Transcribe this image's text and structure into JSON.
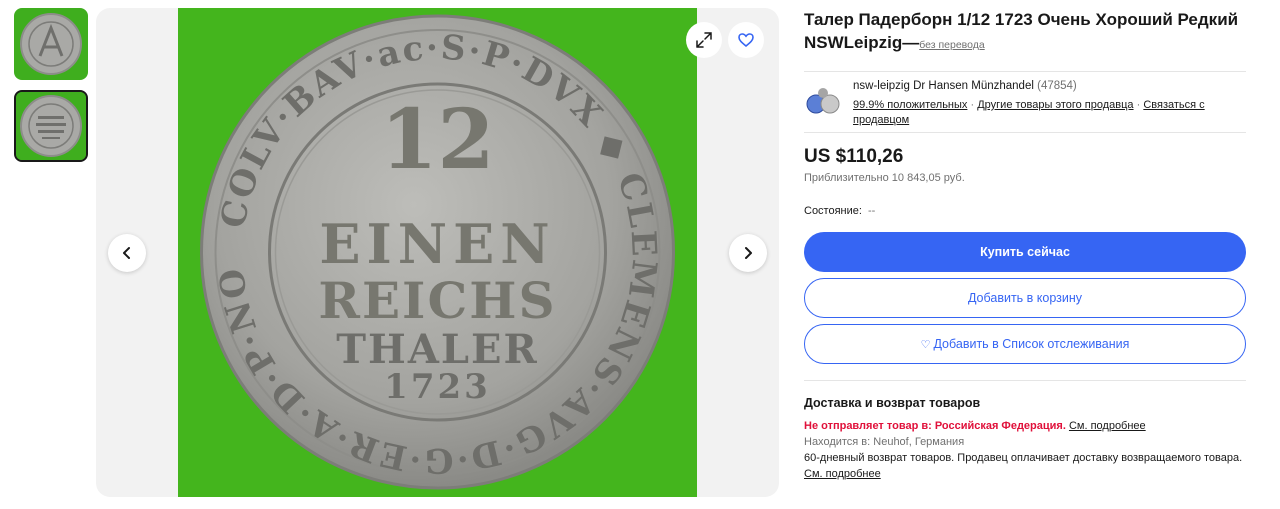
{
  "gallery": {
    "thumbnails": [
      {
        "name": "coin-obverse-thumbnail",
        "active": false
      },
      {
        "name": "coin-reverse-thumbnail",
        "active": true
      }
    ],
    "coin_inscription": {
      "rim_text": "COLV·BAV·ac·S·P·DVX ◆ CLEMENS·AVG·D·G·ER·A·D·P·NOW·",
      "numeral": "12",
      "line1": "EINEN",
      "line2": "REICHS",
      "line3": "THALER",
      "year": "1723"
    }
  },
  "listing": {
    "title": "Талер Падерборн 1/12 1723 Очень Хороший Редкий NSWLeipzig—",
    "no_translation": "без перевода"
  },
  "seller": {
    "name": "nsw-leipzig Dr Hansen Münzhandel",
    "feedback_count": "(47854)",
    "positive": "99.9% положительных",
    "other_items": "Другие товары этого продавца",
    "contact": "Связаться с продавцом"
  },
  "pricing": {
    "price": "US $110,26",
    "approx": "Приблизительно 10 843,05 руб."
  },
  "condition": {
    "label": "Состояние:",
    "value": "--"
  },
  "actions": {
    "buy_now": "Купить сейчас",
    "add_to_cart": "Добавить в корзину",
    "watchlist": "Добавить в Список отслеживания"
  },
  "shipping": {
    "title": "Доставка и возврат товаров",
    "warning": "Не отправляет товар в: Российская Федерация.",
    "see_more_1": "См. подробнее",
    "location": "Находится в: Neuhof, Германия",
    "returns": "60-дневный возврат товаров. Продавец оплачивает доставку возвращаемого товара.",
    "see_more_2": "См. подробнее"
  },
  "colors": {
    "primary": "#3665f3",
    "warning": "#e0103a",
    "photo_background": "#44b51d",
    "coin": "#a8a8a4"
  },
  "icons": [
    "chevron-left-icon",
    "chevron-right-icon",
    "expand-icon",
    "heart-icon"
  ]
}
